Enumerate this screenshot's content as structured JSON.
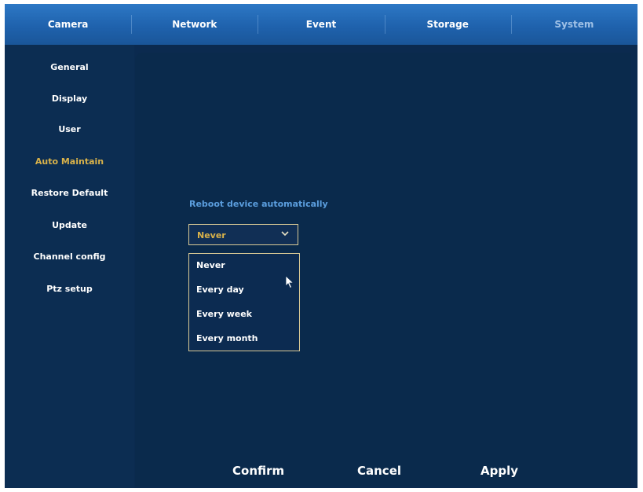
{
  "top_tabs": [
    {
      "label": "Camera"
    },
    {
      "label": "Network"
    },
    {
      "label": "Event"
    },
    {
      "label": "Storage"
    },
    {
      "label": "System",
      "active": true
    }
  ],
  "sidebar": {
    "items": [
      {
        "label": "General"
      },
      {
        "label": "Display"
      },
      {
        "label": "User"
      },
      {
        "label": "Auto Maintain",
        "active": true
      },
      {
        "label": "Restore Default"
      },
      {
        "label": "Update"
      },
      {
        "label": "Channel config"
      },
      {
        "label": "Ptz setup"
      }
    ]
  },
  "main": {
    "reboot_label": "Reboot device automatically",
    "reboot_select": {
      "value": "Never",
      "options": [
        "Never",
        "Every day",
        "Every week",
        "Every month"
      ]
    }
  },
  "footer": {
    "confirm_label": "Confirm",
    "cancel_label": "Cancel",
    "apply_label": "Apply"
  },
  "colors": {
    "background": "#0b2a4f",
    "tab_bar": "#1f62ad",
    "active_item": "#d9b24a",
    "label_blue": "#5b9ede",
    "border_gold": "#d9c995"
  },
  "icons": {
    "select_arrow": "chevron-down-icon",
    "pointer": "mouse-cursor-icon"
  }
}
